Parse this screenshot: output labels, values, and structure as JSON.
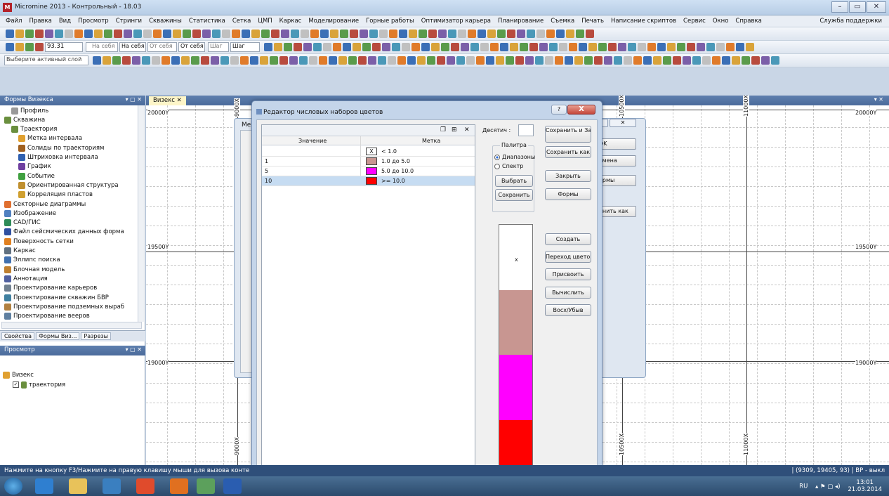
{
  "window": {
    "title": "Micromine 2013 - Контрольный - 18.03"
  },
  "menu": {
    "items": [
      "Файл",
      "Правка",
      "Вид",
      "Просмотр",
      "Стринги",
      "Скважины",
      "Статистика",
      "Сетка",
      "ЦМП",
      "Каркас",
      "Моделирование",
      "Горные работы",
      "Оптимизатор карьера",
      "Планирование",
      "Съемка",
      "Печать",
      "Написание скриптов",
      "Сервис",
      "Окно",
      "Справка"
    ],
    "support": "Служба поддержки"
  },
  "toolbar2": {
    "value": "93.31",
    "on_self_1": "На себя",
    "on_self_2": "На себя",
    "from_self": "От себя",
    "from_self_2": "От себя",
    "step_1": "Шаг",
    "step_2": "Шаг"
  },
  "toolbar3": {
    "layer_placeholder": "Выберите активный слой"
  },
  "left_pane": {
    "title": "Формы Визекса",
    "items": [
      {
        "label": "Профиль",
        "level": 1,
        "color": "#999999"
      },
      {
        "label": "Скважина",
        "level": 0,
        "color": "#6a8f3e"
      },
      {
        "label": "Траектория",
        "level": 1,
        "color": "#6a8f3e"
      },
      {
        "label": "Метка интервала",
        "level": 2,
        "color": "#e0a030"
      },
      {
        "label": "Солиды по траекториям",
        "level": 2,
        "color": "#a06020"
      },
      {
        "label": "Штриховка интервала",
        "level": 2,
        "color": "#3060b0"
      },
      {
        "label": "График",
        "level": 2,
        "color": "#7040a0"
      },
      {
        "label": "Событие",
        "level": 2,
        "color": "#40a040"
      },
      {
        "label": "Ориентированная структура",
        "level": 2,
        "color": "#c09030"
      },
      {
        "label": "Корреляция пластов",
        "level": 2,
        "color": "#d0a030"
      },
      {
        "label": "Секторные диаграммы",
        "level": 0,
        "color": "#e07030"
      },
      {
        "label": "Изображение",
        "level": 0,
        "color": "#5080c0"
      },
      {
        "label": "CAD/ГИС",
        "level": 0,
        "color": "#2e8b57"
      },
      {
        "label": "Файл сейсмических данных форма",
        "level": 0,
        "color": "#3050a0"
      },
      {
        "label": "Поверхность сетки",
        "level": 0,
        "color": "#e08020"
      },
      {
        "label": "Каркас",
        "level": 0,
        "color": "#607080"
      },
      {
        "label": "Эллипс поиска",
        "level": 0,
        "color": "#4070b0"
      },
      {
        "label": "Блочная модель",
        "level": 0,
        "color": "#c08030"
      },
      {
        "label": "Аннотация",
        "level": 0,
        "color": "#5060a0"
      },
      {
        "label": "Проектирование карьеров",
        "level": 0,
        "color": "#708090"
      },
      {
        "label": "Проектирование скважин БВР",
        "level": 0,
        "color": "#4080a0"
      },
      {
        "label": "Проектирование подземных выраб",
        "level": 0,
        "color": "#b08040"
      },
      {
        "label": "Проектирование вееров",
        "level": 0,
        "color": "#6080a0"
      }
    ],
    "tabs": [
      "Свойства",
      "Формы Виз...",
      "Разрезы"
    ]
  },
  "view_pane": {
    "title": "Просмотр",
    "root": "Визекс",
    "child": "траектория"
  },
  "doc": {
    "tab": "Визекс",
    "y_labels": [
      "20000Y",
      "19500Y",
      "19000Y"
    ],
    "x_labels": [
      "9000X",
      "10500X",
      "11000X"
    ]
  },
  "back_dialog": {
    "title_partial": "Ме",
    "buttons": [
      "OK",
      "тмена",
      "ормы",
      "анить как"
    ]
  },
  "dialog": {
    "title": "Редактор числовых наборов цветов",
    "help": "?",
    "close": "X",
    "grid_toolbar": [
      "❐",
      "⊞",
      "✕"
    ],
    "columns": [
      "Значение",
      "Метка"
    ],
    "rows": [
      {
        "value": "",
        "color": "#ffffff",
        "swatch_text": "X",
        "label": "< 1.0"
      },
      {
        "value": "1",
        "color": "#c89691",
        "swatch_text": "",
        "label": "1.0 до 5.0"
      },
      {
        "value": "5",
        "color": "#ff00ff",
        "swatch_text": "",
        "label": "5.0 до 10.0"
      },
      {
        "value": "10",
        "color": "#ff0000",
        "swatch_text": "",
        "label": ">= 10.0"
      }
    ],
    "decimals_label": "Десятич :",
    "palette_label": "Палитра",
    "radio_ranges": "Диапазоны",
    "radio_spectrum": "Спектр",
    "btn_choose": "Выбрать",
    "btn_save": "Сохранить",
    "btn_save_close": "Сохранить и Закрыть",
    "btn_save_as": "Сохранить как",
    "btn_close": "Закрыть",
    "btn_forms": "Формы",
    "btn_create": "Создать",
    "btn_transition": "Переход цветов",
    "btn_assign": "Присвоить",
    "btn_calculate": "Вычислить",
    "btn_asc_desc": "Восх/Убыв",
    "preview_x": "x",
    "preview_colors": [
      "#ffffff",
      "#c89691",
      "#ff00ff",
      "#ff0000"
    ]
  },
  "statusbar": {
    "text": "Нажмите на кнопку F3/Нажмите на правую клавишу мыши для вызова конте",
    "coords": "(9309, 19405, 93)",
    "mode": "BP - выкл"
  },
  "taskbar": {
    "lang": "RU",
    "time": "13:01",
    "date": "21.03.2014"
  }
}
